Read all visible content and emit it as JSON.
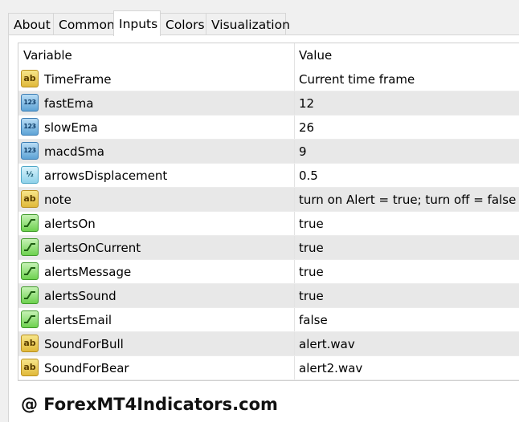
{
  "tabs": [
    {
      "label": "About",
      "active": false
    },
    {
      "label": "Common",
      "active": false
    },
    {
      "label": "Inputs",
      "active": true
    },
    {
      "label": "Colors",
      "active": false
    },
    {
      "label": "Visualization",
      "active": false
    }
  ],
  "table": {
    "columns": {
      "variable": "Variable",
      "value": "Value"
    },
    "rows": [
      {
        "icon": "ab-string-icon",
        "name": "TimeFrame",
        "value": "Current time frame"
      },
      {
        "icon": "123-integer-icon",
        "name": "fastEma",
        "value": "12"
      },
      {
        "icon": "123-integer-icon",
        "name": "slowEma",
        "value": "26"
      },
      {
        "icon": "123-integer-icon",
        "name": "macdSma",
        "value": "9"
      },
      {
        "icon": "half-double-icon",
        "name": "arrowsDisplacement",
        "value": "0.5"
      },
      {
        "icon": "ab-string-icon",
        "name": "note",
        "value": "turn on Alert = true; turn off = false"
      },
      {
        "icon": "bool-toggle-icon",
        "name": "alertsOn",
        "value": "true"
      },
      {
        "icon": "bool-toggle-icon",
        "name": "alertsOnCurrent",
        "value": "true"
      },
      {
        "icon": "bool-toggle-icon",
        "name": "alertsMessage",
        "value": "true"
      },
      {
        "icon": "bool-toggle-icon",
        "name": "alertsSound",
        "value": "true"
      },
      {
        "icon": "bool-toggle-icon",
        "name": "alertsEmail",
        "value": "false"
      },
      {
        "icon": "ab-string-icon",
        "name": "SoundForBull",
        "value": "alert.wav"
      },
      {
        "icon": "ab-string-icon",
        "name": "SoundForBear",
        "value": "alert2.wav"
      }
    ]
  },
  "icon_glyphs": {
    "ab": "ab",
    "num": "123",
    "frac": "½"
  },
  "watermark": "@ ForexMT4Indicators.com"
}
